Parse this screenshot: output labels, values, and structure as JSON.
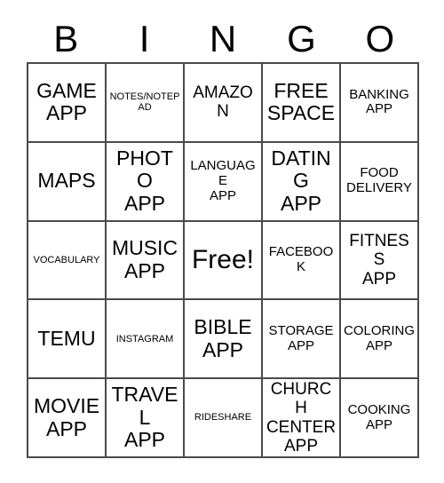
{
  "header": {
    "letters": [
      "B",
      "I",
      "N",
      "G",
      "O"
    ]
  },
  "grid": {
    "rows": 5,
    "columns": 5,
    "border_color": "#4a4a4a",
    "background_color": "#ffffff",
    "text_color": "#000000",
    "cells": [
      {
        "text": "GAME\nAPP",
        "size": "fs-lg",
        "column": "B",
        "row": 1
      },
      {
        "text": "NOTES/NOTEPAD",
        "size": "fs-xs",
        "column": "I",
        "row": 1
      },
      {
        "text": "AMAZON",
        "size": "fs-md",
        "column": "N",
        "row": 1
      },
      {
        "text": "FREE\nSPACE",
        "size": "fs-lg",
        "column": "G",
        "row": 1
      },
      {
        "text": "BANKING\nAPP",
        "size": "fs-sm",
        "column": "O",
        "row": 1
      },
      {
        "text": "MAPS",
        "size": "fs-lg",
        "column": "B",
        "row": 2
      },
      {
        "text": "PHOTO\nAPP",
        "size": "fs-lg",
        "column": "I",
        "row": 2
      },
      {
        "text": "LANGUAGE\nAPP",
        "size": "fs-sm",
        "column": "N",
        "row": 2
      },
      {
        "text": "DATING\nAPP",
        "size": "fs-lg",
        "column": "G",
        "row": 2
      },
      {
        "text": "FOOD\nDELIVERY",
        "size": "fs-sm",
        "column": "O",
        "row": 2
      },
      {
        "text": "VOCABULARY",
        "size": "fs-xs",
        "column": "B",
        "row": 3
      },
      {
        "text": "MUSIC\nAPP",
        "size": "fs-lg",
        "column": "I",
        "row": 3
      },
      {
        "text": "Free!",
        "size": "fs-xl",
        "column": "N",
        "row": 3,
        "is_free_space": true
      },
      {
        "text": "FACEBOOK",
        "size": "fs-sm",
        "column": "G",
        "row": 3
      },
      {
        "text": "FITNESS\nAPP",
        "size": "fs-md",
        "column": "O",
        "row": 3
      },
      {
        "text": "TEMU",
        "size": "fs-lg",
        "column": "B",
        "row": 4
      },
      {
        "text": "INSTAGRAM",
        "size": "fs-xs",
        "column": "I",
        "row": 4
      },
      {
        "text": "BIBLE\nAPP",
        "size": "fs-lg",
        "column": "N",
        "row": 4
      },
      {
        "text": "STORAGE\nAPP",
        "size": "fs-sm",
        "column": "G",
        "row": 4
      },
      {
        "text": "COLORING\nAPP",
        "size": "fs-sm",
        "column": "O",
        "row": 4
      },
      {
        "text": "MOVIE\nAPP",
        "size": "fs-lg",
        "column": "B",
        "row": 5
      },
      {
        "text": "TRAVEL\nAPP",
        "size": "fs-lg",
        "column": "I",
        "row": 5
      },
      {
        "text": "RIDESHARE",
        "size": "fs-xs",
        "column": "N",
        "row": 5
      },
      {
        "text": "CHURCH\nCENTER\nAPP",
        "size": "fs-md",
        "column": "G",
        "row": 5
      },
      {
        "text": "COOKING\nAPP",
        "size": "fs-sm",
        "column": "O",
        "row": 5
      }
    ]
  }
}
